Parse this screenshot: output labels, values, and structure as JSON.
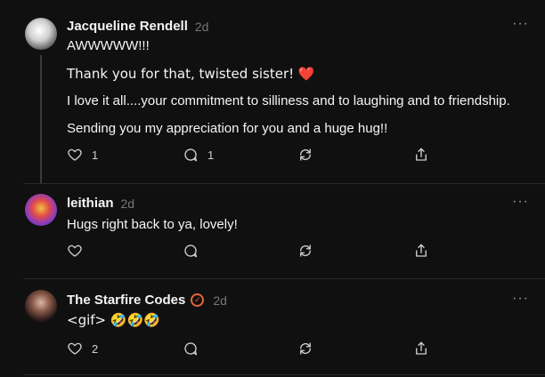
{
  "posts": [
    {
      "username": "Jacqueline Rendell",
      "time": "2d",
      "verified": false,
      "lines": [
        "AWWWWW!!!",
        "Thank you for that, twisted sister! ❤️",
        "I love it all....your commitment to silliness and to laughing and to friendship.",
        "Sending you my appreciation for you and a huge hug!!"
      ],
      "likes": "1",
      "replies": "1"
    },
    {
      "username": "leithian",
      "time": "2d",
      "verified": false,
      "lines": [
        "Hugs right back to ya, lovely!"
      ],
      "likes": "",
      "replies": ""
    },
    {
      "username": "The Starfire Codes",
      "time": "2d",
      "verified": true,
      "lines": [
        "<gif> 🤣🤣🤣"
      ],
      "likes": "2",
      "replies": ""
    }
  ],
  "more_label": "···",
  "icons": [
    "heart-icon",
    "comment-icon",
    "repost-icon",
    "share-icon",
    "more-icon",
    "verified-icon"
  ],
  "colors": {
    "background": "#101010",
    "text": "#f3f5f7",
    "muted": "#777777",
    "verified": "#e8663a"
  }
}
